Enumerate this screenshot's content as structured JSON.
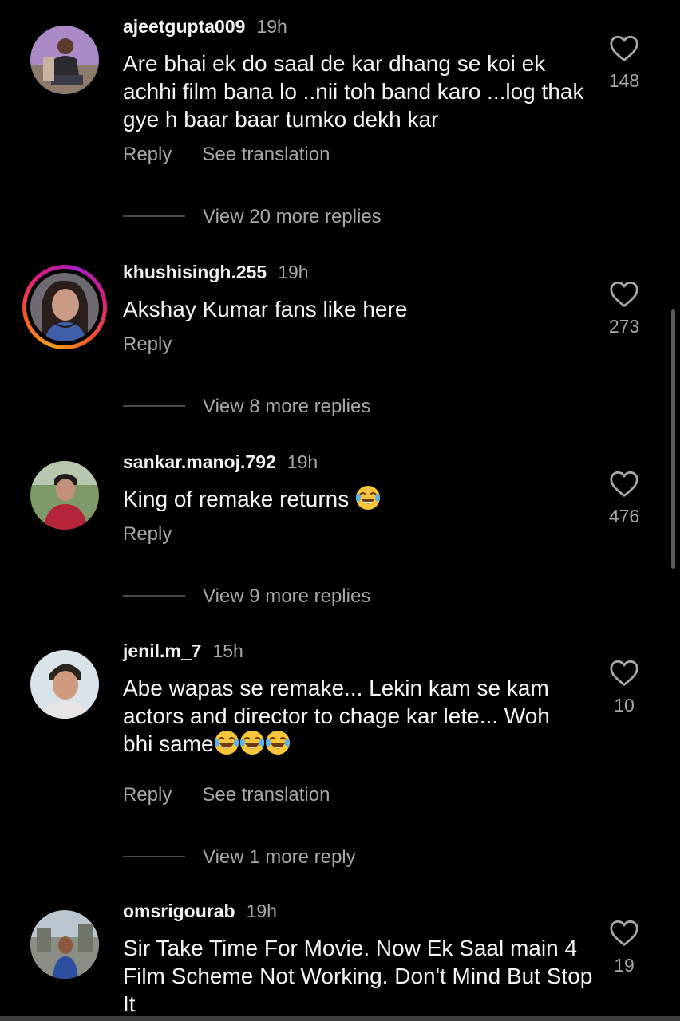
{
  "colors": {
    "background": "#000000",
    "text_primary": "#f5f5f5",
    "text_secondary": "#a8a8a8",
    "story_ring": [
      "#f9a01b",
      "#d81d7e",
      "#a51fc0"
    ]
  },
  "comments": [
    {
      "username": "ajeetgupta009",
      "time": "19h",
      "text": "Are bhai ek do saal de kar dhang se koi ek achhi film bana lo ..nii toh band karo ...log thak gye h baar baar tumko dekh kar",
      "reply_label": "Reply",
      "translation_label": "See translation",
      "likes": "148",
      "view_replies": "View 20 more replies",
      "has_story": false
    },
    {
      "username": "khushisingh.255",
      "time": "19h",
      "text": "Akshay Kumar fans like here",
      "reply_label": "Reply",
      "likes": "273",
      "view_replies": "View 8 more replies",
      "has_story": true
    },
    {
      "username": "sankar.manoj.792",
      "time": "19h",
      "text": "King of remake returns",
      "reply_label": "Reply",
      "likes": "476",
      "view_replies": "View 9 more replies",
      "has_story": false
    },
    {
      "username": "jenil.m_7",
      "time": "15h",
      "text_line1": "Abe wapas se remake... Lekin kam se kam",
      "text_line2": "actors and director to chage kar lete... Woh",
      "text_line3": "bhi same",
      "reply_label": "Reply",
      "translation_label": "See translation",
      "likes": "10",
      "view_replies": "View 1 more reply",
      "has_story": false
    },
    {
      "username": "omsrigourab",
      "time": "19h",
      "text": "Sir Take Time For Movie. Now Ek Saal main 4 Film Scheme Not Working. Don't Mind But Stop It",
      "likes": "19",
      "has_story": false
    }
  ],
  "icons": {
    "like": "heart-outline-icon",
    "laugh": "face-with-tears-of-joy-emoji"
  }
}
